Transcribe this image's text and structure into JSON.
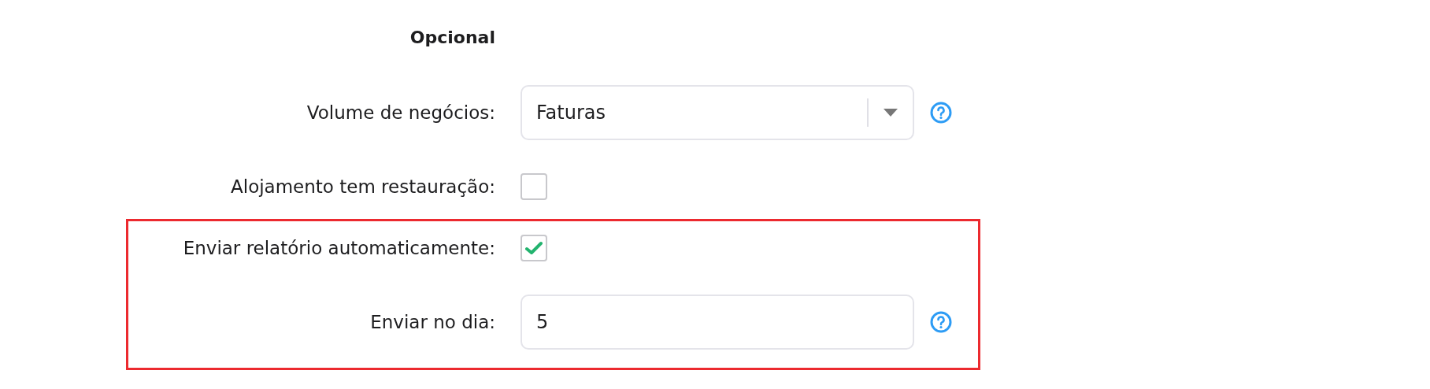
{
  "section_title": "Opcional",
  "groups": [
    {
      "highlighted": false,
      "fields": [
        {
          "kind": "select",
          "label": "Volume de negócios:",
          "value": "Faturas",
          "help": true
        },
        {
          "kind": "checkbox",
          "label": "Alojamento tem restauração:",
          "checked": false
        }
      ]
    },
    {
      "highlighted": true,
      "fields": [
        {
          "kind": "checkbox",
          "label": "Enviar relatório automaticamente:",
          "checked": true
        },
        {
          "kind": "text",
          "label": "Enviar no dia:",
          "value": "5",
          "help": true
        }
      ]
    }
  ]
}
